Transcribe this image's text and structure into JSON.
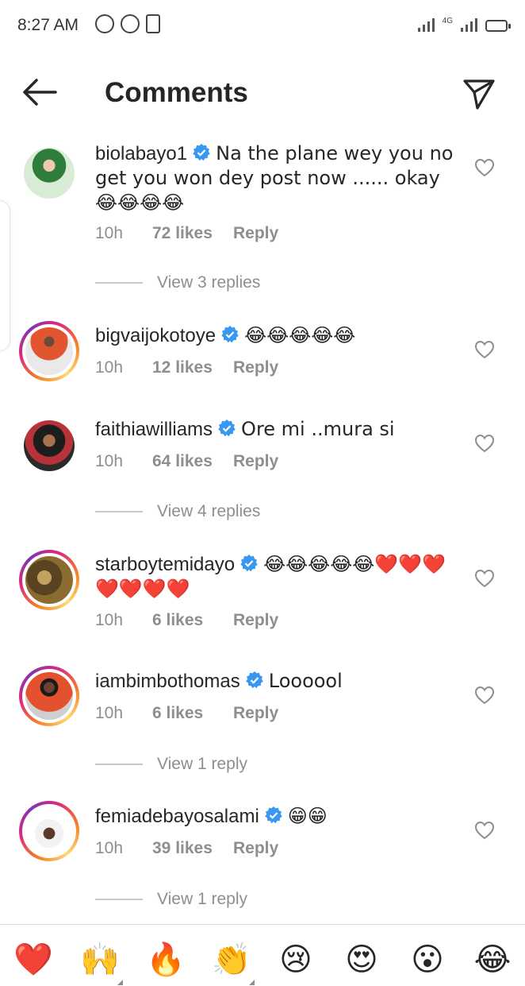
{
  "status_bar": {
    "time": "8:27 AM",
    "network": "4G"
  },
  "header": {
    "title": "Comments"
  },
  "comments": [
    {
      "username": "biolabayo1",
      "text": "Na the plane wey you no get you won dey post now ...... okay 😂😂😂😂",
      "time": "10h",
      "likes": "72 likes",
      "reply": "Reply",
      "view_replies": "View 3 replies"
    },
    {
      "username": "bigvaijokotoye",
      "text": "😂😂😂😂😂",
      "time": "10h",
      "likes": "12 likes",
      "reply": "Reply"
    },
    {
      "username": "faithiawilliams",
      "text": "Ore mi ..mura si",
      "time": "10h",
      "likes": "64 likes",
      "reply": "Reply",
      "view_replies": "View 4 replies"
    },
    {
      "username": "starboytemidayo",
      "text": "😂😂😂😂😂❤️❤️❤️❤️❤️❤️❤️",
      "time": "10h",
      "likes": "6 likes",
      "reply": "Reply"
    },
    {
      "username": "iambimbothomas",
      "text": "Loooool",
      "time": "10h",
      "likes": "6 likes",
      "reply": "Reply",
      "view_replies": "View 1 reply"
    },
    {
      "username": "femiadebayosalami",
      "text": "😁😁",
      "time": "10h",
      "likes": "39 likes",
      "reply": "Reply",
      "view_replies": "View 1 reply"
    }
  ],
  "reactions": [
    "❤️",
    "🙌",
    "🔥",
    "👏",
    "😢",
    "😍",
    "😮",
    "😂"
  ],
  "colors": {
    "verified": "#3897f0",
    "meta_gray": "#8e8e8e",
    "text": "#262626"
  }
}
